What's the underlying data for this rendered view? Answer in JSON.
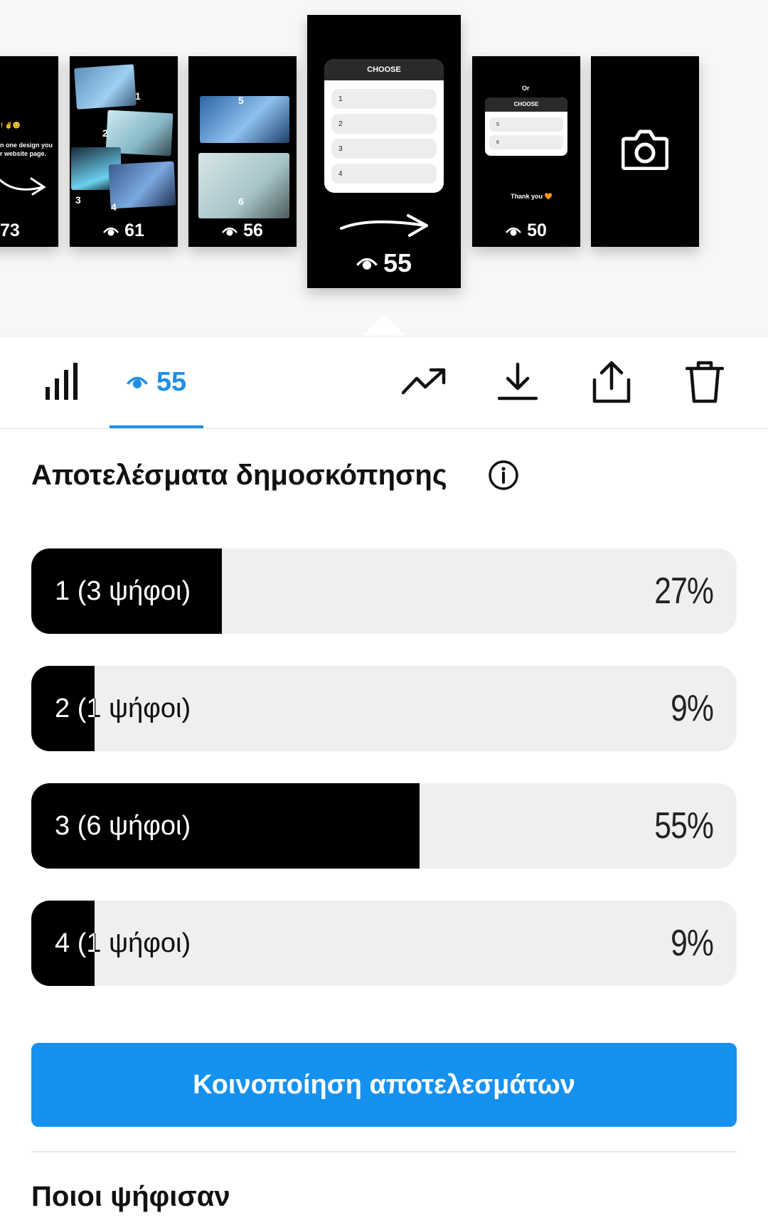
{
  "stories": [
    {
      "views": "73",
      "lines": [
        ", ! ✌😊",
        "n one design you",
        "r website page."
      ]
    },
    {
      "views": "61",
      "numbers": [
        "1",
        "2",
        "3",
        "4"
      ]
    },
    {
      "views": "56",
      "numbers": [
        "5",
        "6"
      ]
    },
    {
      "views": "55",
      "poll_header": "CHOOSE",
      "options": [
        "1",
        "2",
        "3",
        "4"
      ],
      "active": true
    },
    {
      "views": "50",
      "top_text": "Or",
      "poll_header": "CHOOSE",
      "options": [
        "5",
        "6"
      ],
      "thanks": "Thank you 🧡"
    },
    {
      "views": "",
      "icon": "camera-icon"
    }
  ],
  "toolbar": {
    "insights_icon": "bar-chart-icon",
    "views_count": "55",
    "actions": [
      "trending-icon",
      "download-icon",
      "share-icon",
      "trash-icon"
    ]
  },
  "poll": {
    "title": "Αποτελέσματα δημοσκόπησης",
    "options": [
      {
        "label": "1 (3 ψήφοι)",
        "percent_text": "27%",
        "fraction": 0.27
      },
      {
        "label": "2 (1 ψήφοι)",
        "percent_text": "9%",
        "fraction": 0.09
      },
      {
        "label": "3 (6 ψήφοι)",
        "percent_text": "55%",
        "fraction": 0.55
      },
      {
        "label": "4 (1 ψήφοι)",
        "percent_text": "9%",
        "fraction": 0.09
      }
    ],
    "share_button": "Κοινοποίηση αποτελεσμάτων",
    "voters_title": "Ποιοι ψήφισαν"
  },
  "colors": {
    "accent": "#1591f0",
    "fill": "#000000",
    "track": "#efefef"
  }
}
